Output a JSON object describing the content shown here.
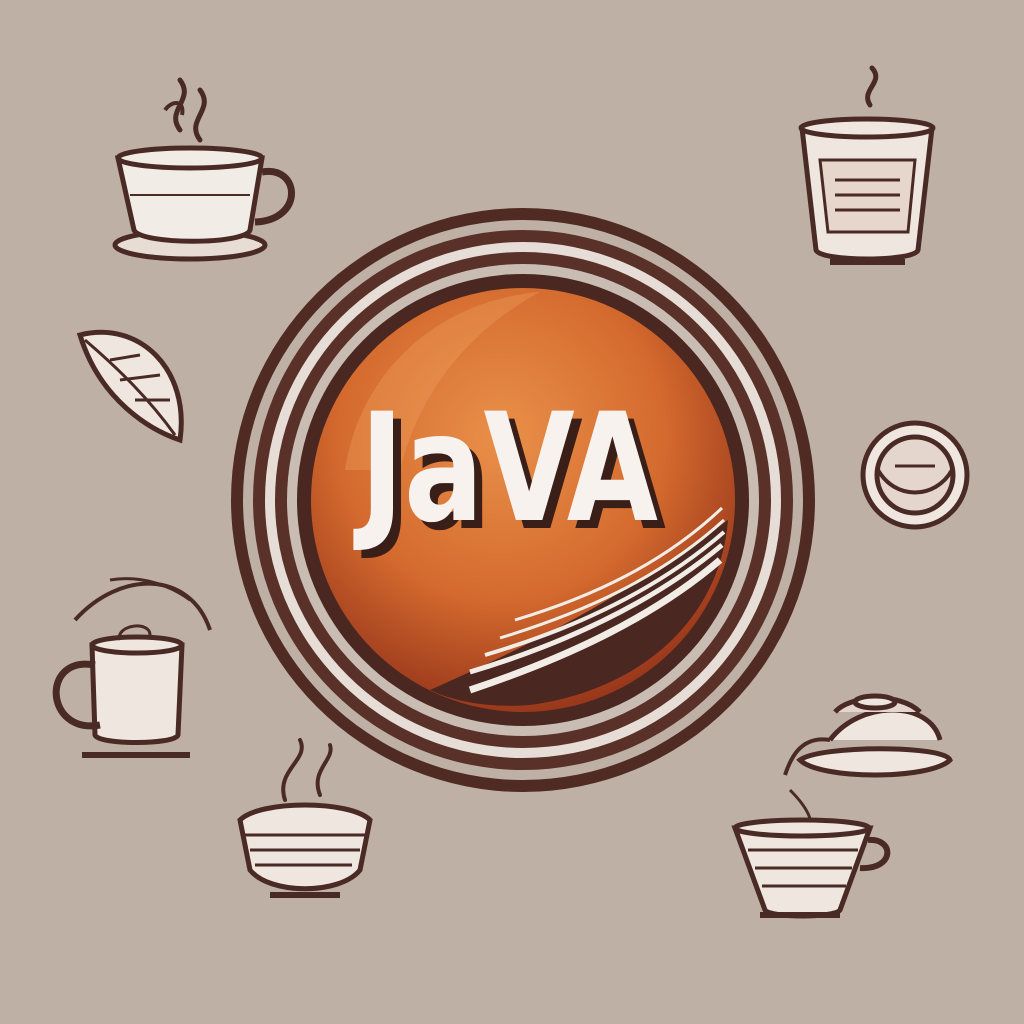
{
  "logo": {
    "wordmark": "JaVA"
  },
  "icons": [
    {
      "name": "steaming-cup-icon"
    },
    {
      "name": "tall-glass-icon"
    },
    {
      "name": "coffee-leaf-icon"
    },
    {
      "name": "bowl-icon"
    },
    {
      "name": "mug-with-leaf-icon"
    },
    {
      "name": "teapot-icon"
    },
    {
      "name": "steaming-bowl-icon"
    },
    {
      "name": "pour-over-cup-icon"
    }
  ],
  "colors": {
    "background": "#bfb0a5",
    "ink": "#4a2a24",
    "cream": "#f2ece6",
    "orange_light": "#e58a3e",
    "orange_dark": "#a83a1c",
    "ring": "#5a3129"
  }
}
